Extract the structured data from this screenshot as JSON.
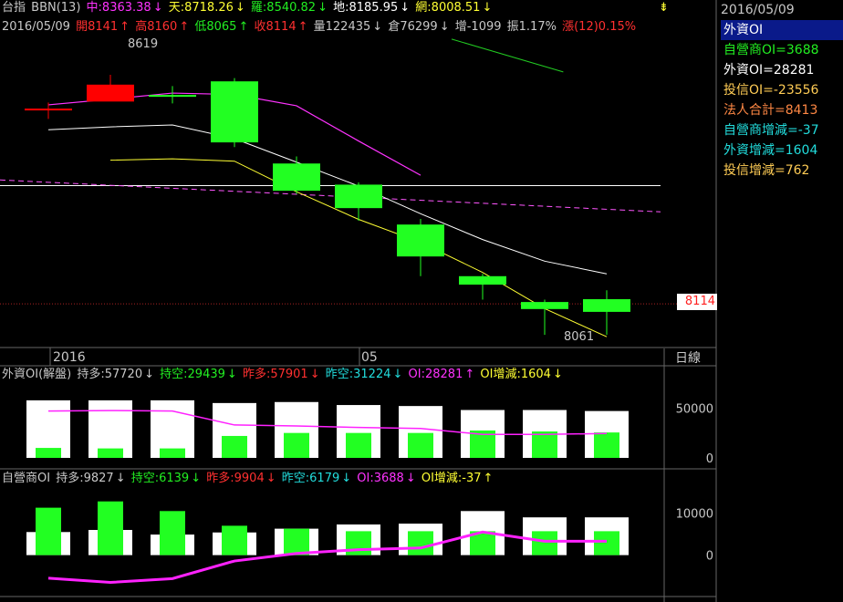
{
  "top_row": {
    "instrument": "台指",
    "indicator": "BBN(13)",
    "mid": "中:8363.38",
    "sky": "天:8718.26",
    "luo": "羅:8540.82",
    "di": "地:8185.95",
    "wang": "網:8008.51"
  },
  "quote_row": {
    "date": "2016/05/09",
    "open": "開8141",
    "high": "高8160",
    "low": "低8065",
    "close": "收8114",
    "volume": "量122435",
    "oi": "倉76299",
    "oi_change": "增-1099",
    "amplitude": "振1.17%",
    "change": "漲(12)0.15%"
  },
  "side_panel": {
    "date": "2016/05/09",
    "items": [
      {
        "label": "外資OI",
        "color": "#ffffff",
        "selected": true
      },
      {
        "label": "自營商OI=3688",
        "color": "#22ee22"
      },
      {
        "label": "外資OI=28281",
        "color": "#ffffff"
      },
      {
        "label": "投信OI=-23556",
        "color": "#ffcc55"
      },
      {
        "label": "法人合計=8413",
        "color": "#ff8844"
      },
      {
        "label": "自營商增減=-37",
        "color": "#22dddd"
      },
      {
        "label": "外資增減=1604",
        "color": "#22dddd"
      },
      {
        "label": "投信增減=762",
        "color": "#ffcc55"
      }
    ]
  },
  "price_tag": "8114",
  "annotations": {
    "high": "8619",
    "low": "8061"
  },
  "axis": {
    "year_label": "2016",
    "month_label": "05",
    "period": "日線"
  },
  "foreign_row": {
    "title": "外資OI(解盤)",
    "long": "持多:57720",
    "short": "持空:29439",
    "prev_long": "昨多:57901",
    "prev_short": "昨空:31224",
    "oi": "OI:28281",
    "oi_change": "OI增減:1604"
  },
  "dealer_row": {
    "title": "自營商OI",
    "long": "持多:9827",
    "short": "持空:6139",
    "prev_long": "昨多:9904",
    "prev_short": "昨空:6179",
    "oi": "OI:3688",
    "oi_change": "OI增減:-37"
  },
  "colors": {
    "up": "#ff0000",
    "down": "#22ff22",
    "mid_band": "#ffffff",
    "upper_band": "#ff33ff",
    "lower_band": "#ffff33",
    "oi_line": "#ff22ff"
  },
  "chart_data": [
    {
      "type": "candlestick",
      "title": "台指 BBN(13)",
      "ylim": [
        8040,
        8720
      ],
      "candles": [
        {
          "o": 8547,
          "h": 8560,
          "l": 8525,
          "c": 8547
        },
        {
          "o": 8562,
          "h": 8619,
          "l": 8569,
          "c": 8598
        },
        {
          "o": 8576,
          "h": 8595,
          "l": 8558,
          "c": 8576
        },
        {
          "o": 8605,
          "h": 8612,
          "l": 8465,
          "c": 8475
        },
        {
          "o": 8430,
          "h": 8445,
          "l": 8365,
          "c": 8372
        },
        {
          "o": 8385,
          "h": 8390,
          "l": 8308,
          "c": 8335
        },
        {
          "o": 8300,
          "h": 8312,
          "l": 8190,
          "c": 8232
        },
        {
          "o": 8190,
          "h": 8195,
          "l": 8140,
          "c": 8172
        },
        {
          "o": 8135,
          "h": 8140,
          "l": 8065,
          "c": 8120
        },
        {
          "o": 8141,
          "h": 8160,
          "l": 8065,
          "c": 8114
        }
      ],
      "bands": {
        "upper": [
          null,
          null,
          8555,
          8578,
          8582,
          8577,
          8553,
          null,
          null,
          null
        ],
        "upper_x": [
          0.5,
          1.5,
          2.5,
          3.5,
          4.5,
          5.5,
          6.5
        ],
        "sky": [
          8695,
          8625
        ],
        "sky_x": [
          7.0,
          8.8
        ],
        "mid": [
          8502,
          8508,
          8512,
          8483,
          8433,
          8382,
          8323,
          8268,
          8222,
          8195
        ],
        "lower": [
          null,
          8437,
          8440,
          8435,
          8370,
          8311,
          8262,
          8198,
          8121,
          8061
        ]
      },
      "horizontal_lines": [
        8383,
        8131
      ],
      "dashed_trend": [
        8395,
        8327
      ]
    },
    {
      "type": "bar",
      "title": "外資OI(解盤)",
      "ylim": [
        0,
        75000
      ],
      "yticks": [
        0,
        50000
      ],
      "long": [
        57720,
        57720,
        57720,
        55000,
        56000,
        53000,
        52000,
        48000,
        48000,
        47000
      ],
      "short": [
        10000,
        9500,
        9500,
        22000,
        25000,
        25000,
        25000,
        27500,
        26500,
        25500
      ],
      "oi_line": [
        47000,
        47500,
        47000,
        33000,
        32000,
        30500,
        29500,
        23500,
        23500,
        24500
      ]
    },
    {
      "type": "bar",
      "title": "自營商OI",
      "ylim": [
        -9000,
        16000
      ],
      "yticks": [
        0,
        10000
      ],
      "long": [
        5500,
        6000,
        4900,
        5400,
        6300,
        7300,
        7500,
        10500,
        9000,
        9000
      ],
      "short": [
        11300,
        12800,
        10500,
        7000,
        6300,
        5700,
        5700,
        5700,
        5700,
        5700
      ],
      "oi_line": [
        -5500,
        -6500,
        -5600,
        -1400,
        400,
        1300,
        1700,
        5500,
        3300,
        3300
      ]
    }
  ]
}
